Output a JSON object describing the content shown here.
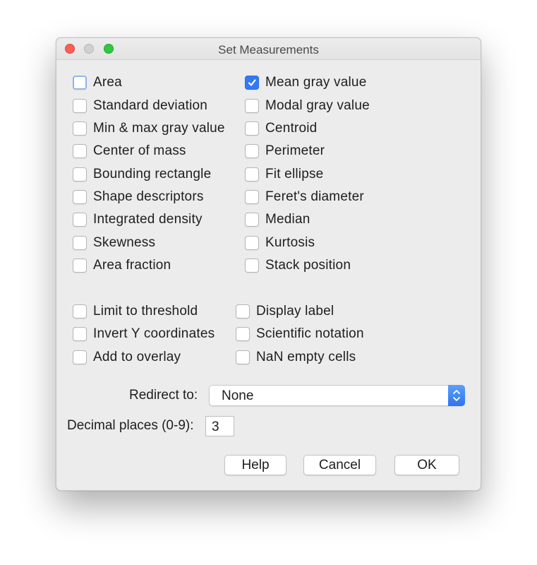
{
  "window": {
    "title": "Set Measurements"
  },
  "measurements": {
    "area": {
      "label": "Area",
      "checked": false
    },
    "mean_gray_value": {
      "label": "Mean gray value",
      "checked": true
    },
    "standard_deviation": {
      "label": "Standard deviation",
      "checked": false
    },
    "modal_gray_value": {
      "label": "Modal gray value",
      "checked": false
    },
    "min_max_gray_value": {
      "label": "Min & max gray value",
      "checked": false
    },
    "centroid": {
      "label": "Centroid",
      "checked": false
    },
    "center_of_mass": {
      "label": "Center of mass",
      "checked": false
    },
    "perimeter": {
      "label": "Perimeter",
      "checked": false
    },
    "bounding_rectangle": {
      "label": "Bounding rectangle",
      "checked": false
    },
    "fit_ellipse": {
      "label": "Fit ellipse",
      "checked": false
    },
    "shape_descriptors": {
      "label": "Shape descriptors",
      "checked": false
    },
    "ferets_diameter": {
      "label": "Feret's diameter",
      "checked": false
    },
    "integrated_density": {
      "label": "Integrated density",
      "checked": false
    },
    "median": {
      "label": "Median",
      "checked": false
    },
    "skewness": {
      "label": "Skewness",
      "checked": false
    },
    "kurtosis": {
      "label": "Kurtosis",
      "checked": false
    },
    "area_fraction": {
      "label": "Area fraction",
      "checked": false
    },
    "stack_position": {
      "label": "Stack position",
      "checked": false
    }
  },
  "options": {
    "limit_to_threshold": {
      "label": "Limit to threshold",
      "checked": false
    },
    "display_label": {
      "label": "Display label",
      "checked": false
    },
    "invert_y_coordinates": {
      "label": "Invert Y coordinates",
      "checked": false
    },
    "scientific_notation": {
      "label": "Scientific notation",
      "checked": false
    },
    "add_to_overlay": {
      "label": "Add to overlay",
      "checked": false
    },
    "nan_empty_cells": {
      "label": "NaN empty cells",
      "checked": false
    }
  },
  "redirect": {
    "label": "Redirect to:",
    "value": "None"
  },
  "decimal_places": {
    "label": "Decimal places (0-9):",
    "value": "3"
  },
  "buttons": {
    "help": "Help",
    "cancel": "Cancel",
    "ok": "OK"
  },
  "colors": {
    "accent": "#3478f6",
    "close": "#fc5f57",
    "zoom": "#2fc840"
  }
}
